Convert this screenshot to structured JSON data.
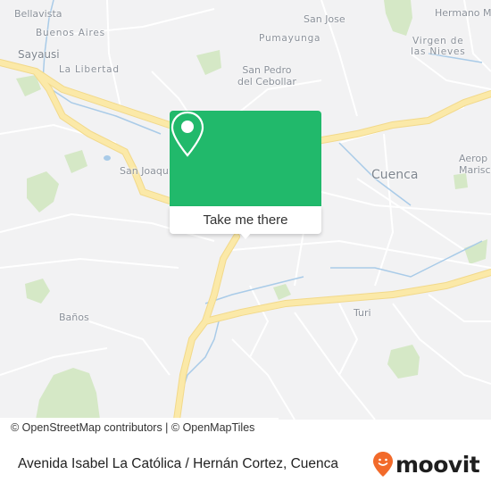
{
  "map": {
    "places": [
      {
        "id": "bellavista",
        "label": "Bellavista"
      },
      {
        "id": "buenos-aires",
        "label": "Buenos Aires"
      },
      {
        "id": "sayausi",
        "label": "Sayausi"
      },
      {
        "id": "la-libertad",
        "label": "La Libertad"
      },
      {
        "id": "san-jose",
        "label": "San Jose"
      },
      {
        "id": "pumayunga",
        "label": "Pumayunga"
      },
      {
        "id": "san-pedro",
        "label": "San Pedro\ndel Cebollar"
      },
      {
        "id": "hermano-miguel",
        "label": "Hermano M"
      },
      {
        "id": "virgen",
        "label": "Virgen de\nlas Nieves"
      },
      {
        "id": "san-joaquin",
        "label": "San Joaquí"
      },
      {
        "id": "cuenca",
        "label": "Cuenca"
      },
      {
        "id": "aeropuerto",
        "label": "Aerop\nMarisca"
      },
      {
        "id": "banos",
        "label": "Baños"
      },
      {
        "id": "turi",
        "label": "Turi"
      }
    ],
    "colors": {
      "land": "#f2f2f3",
      "road_major": "#fbe9a8",
      "road_major_edge": "#f2d98a",
      "road_minor": "#ffffff",
      "water": "#a9cbe8",
      "park": "#cfe5bc"
    }
  },
  "popup": {
    "button_label": "Take me there",
    "icon": "map-pin-icon",
    "color": "#21b96b"
  },
  "attribution": "© OpenStreetMap contributors | © OpenMapTiles",
  "footer": {
    "address": "Avenida Isabel La Católica / Hernán Cortez, Cuenca",
    "brand": "moovit",
    "brand_color": "#f26a2a"
  }
}
